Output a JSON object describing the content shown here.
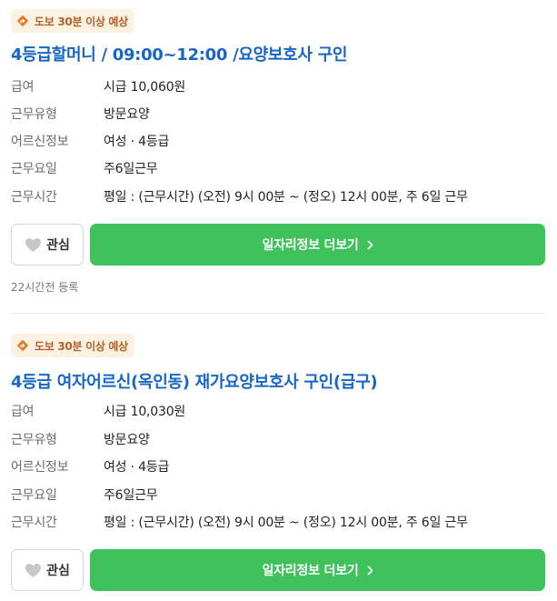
{
  "listings": [
    {
      "badge": "도보 30분 이상 예상",
      "title": "4등급할머니 / 09:00~12:00 /요양보호사 구인",
      "rows": [
        {
          "label": "급여",
          "value": "시급 10,060원"
        },
        {
          "label": "근무유형",
          "value": "방문요양"
        },
        {
          "label": "어르신정보",
          "value": "여성 · 4등급"
        },
        {
          "label": "근무요일",
          "value": "주6일근무"
        },
        {
          "label": "근무시간",
          "value": "평일 : (근무시간) (오전) 9시 00분 ~ (정오) 12시 00분, 주 6일 근무"
        }
      ],
      "like_label": "관심",
      "more_label": "일자리정보 더보기",
      "posted": "22시간전 등록"
    },
    {
      "badge": "도보 30분 이상 예상",
      "title": "4등급 여자어르신(옥인동) 재가요양보호사 구인(급구)",
      "rows": [
        {
          "label": "급여",
          "value": "시급 10,030원"
        },
        {
          "label": "근무유형",
          "value": "방문요양"
        },
        {
          "label": "어르신정보",
          "value": "여성 · 4등급"
        },
        {
          "label": "근무요일",
          "value": "주6일근무"
        },
        {
          "label": "근무시간",
          "value": "평일 : (근무시간) (오전) 9시 00분 ~ (정오) 12시 00분, 주 6일 근무"
        }
      ],
      "like_label": "관심",
      "more_label": "일자리정보 더보기"
    }
  ],
  "colors": {
    "accent_green": "#3fc25b",
    "title_blue": "#1766c6",
    "badge_bg": "#fdf1e4",
    "badge_icon": "#e27a26"
  },
  "icons": [
    "walk-direction-icon",
    "heart-icon",
    "chevron-right-icon"
  ]
}
